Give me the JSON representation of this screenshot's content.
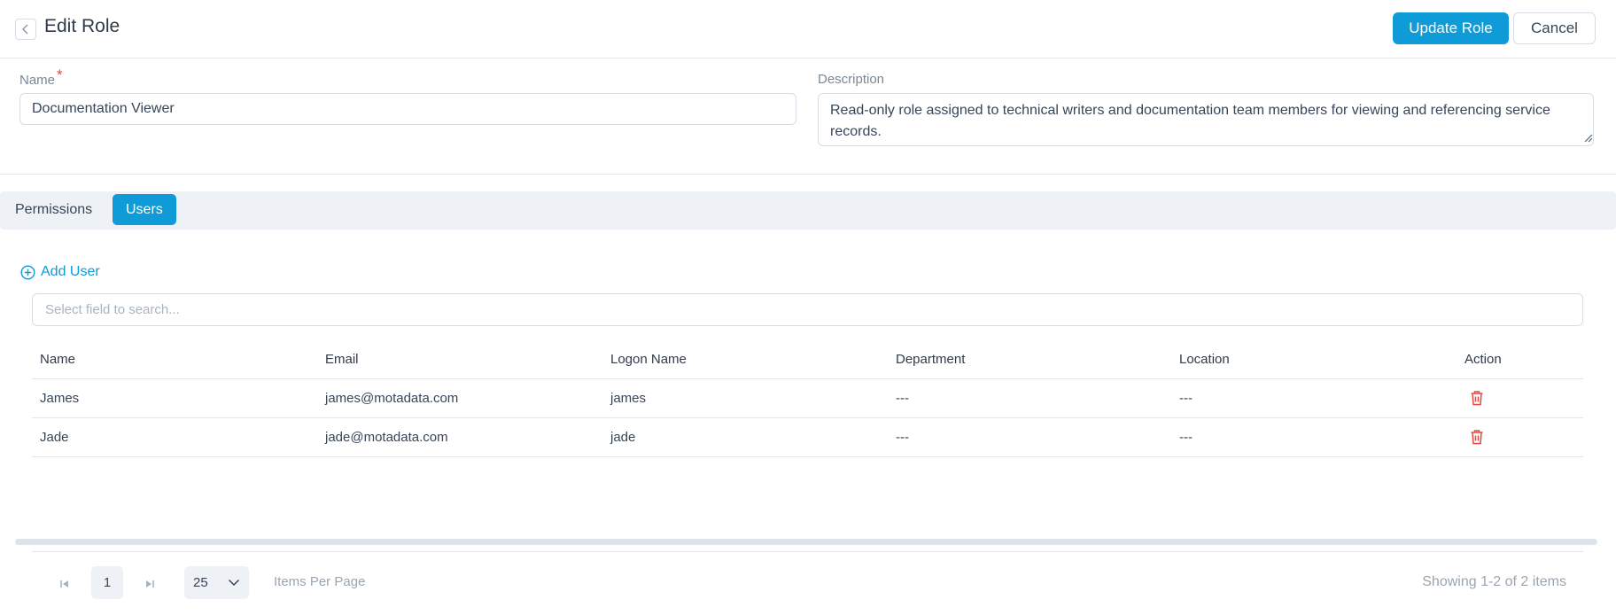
{
  "header": {
    "title": "Edit Role",
    "update_label": "Update Role",
    "cancel_label": "Cancel"
  },
  "form": {
    "name_label": "Name",
    "required_mark": "*",
    "name_value": "Documentation Viewer",
    "description_label": "Description",
    "description_value": "Read-only role assigned to technical writers and documentation team members for viewing and referencing service records."
  },
  "tabs": [
    {
      "label": "Permissions",
      "active": false
    },
    {
      "label": "Users",
      "active": true
    }
  ],
  "users": {
    "add_label": "Add User",
    "search_placeholder": "Select field to search...",
    "columns": [
      "Name",
      "Email",
      "Logon Name",
      "Department",
      "Location",
      "Action"
    ],
    "rows": [
      {
        "name": "James",
        "email": "james@motadata.com",
        "logon": "james",
        "department": "---",
        "location": "---"
      },
      {
        "name": "Jade",
        "email": "jade@motadata.com",
        "logon": "jade",
        "department": "---",
        "location": "---"
      }
    ]
  },
  "pagination": {
    "current_page": "1",
    "page_size": "25",
    "items_per_page_label": "Items Per Page",
    "summary": "Showing 1-2 of 2 items"
  },
  "colors": {
    "accent": "#0f9ad8",
    "danger": "#e5483f"
  }
}
